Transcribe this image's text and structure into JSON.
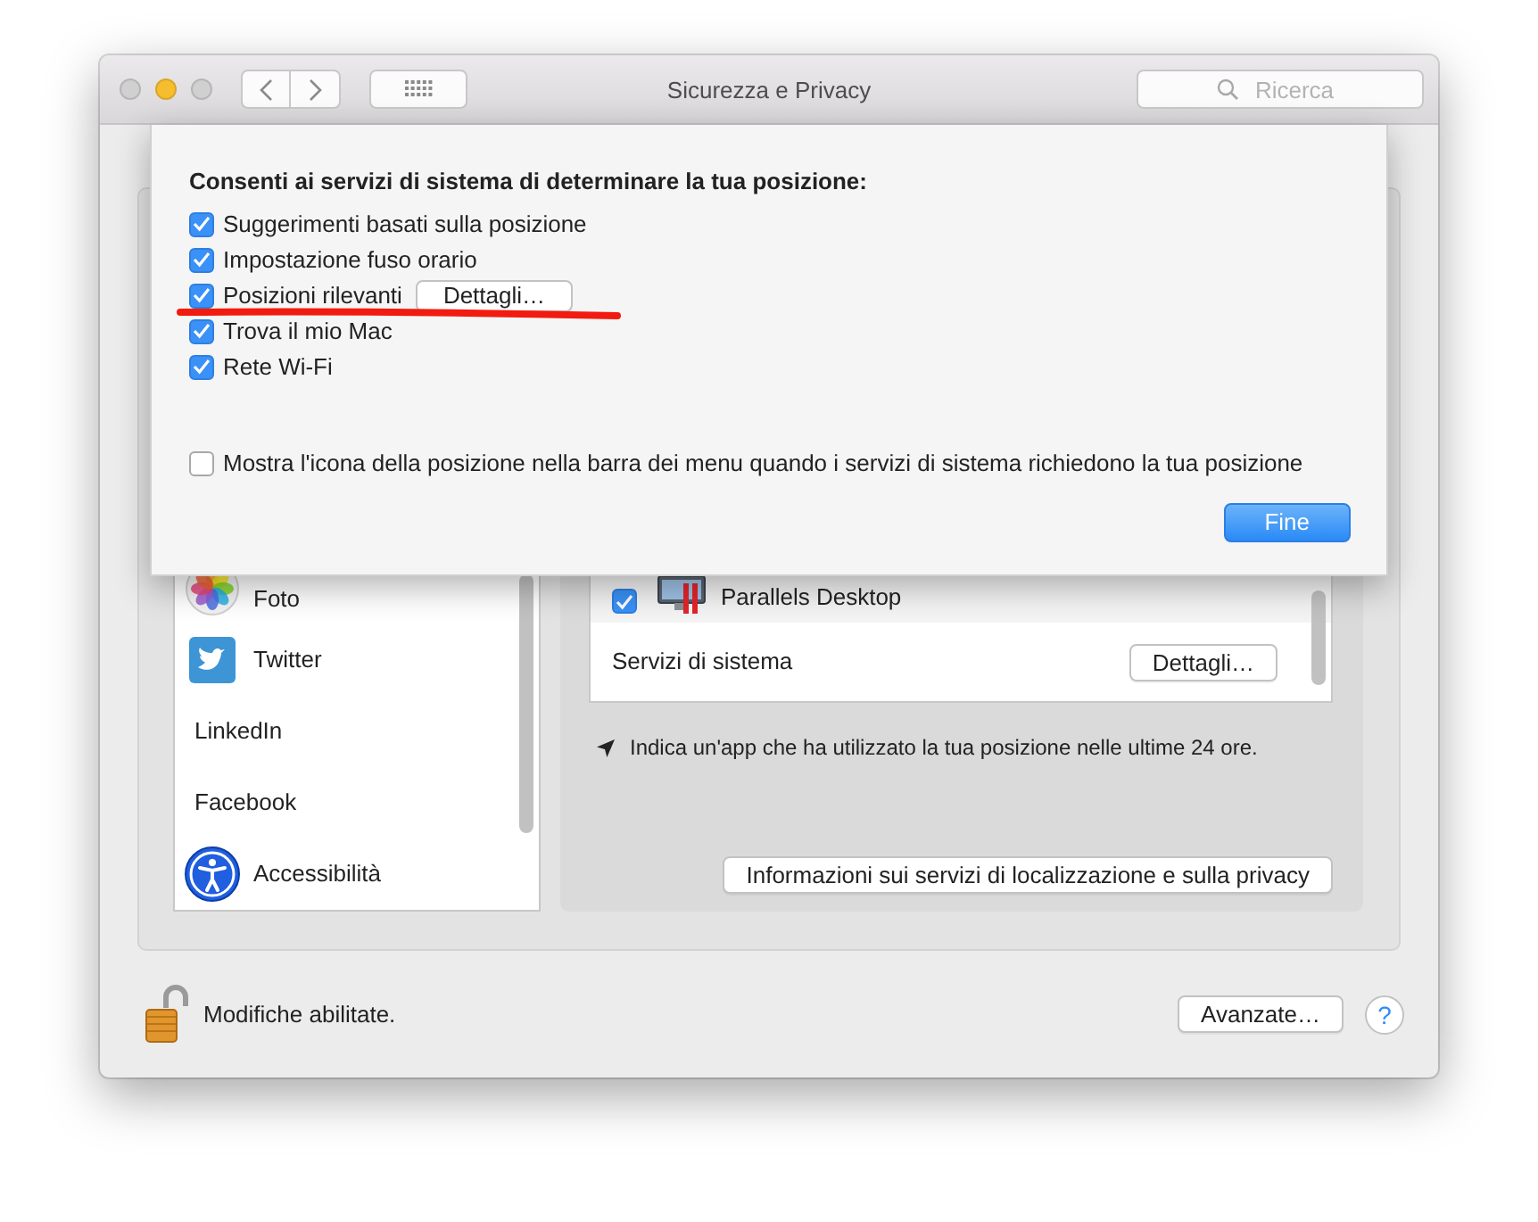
{
  "window": {
    "title": "Sicurezza e Privacy",
    "search": {
      "placeholder": "Ricerca"
    }
  },
  "sheet": {
    "heading": "Consenti ai servizi di sistema di determinare la tua posizione:",
    "services": [
      {
        "label": "Suggerimenti basati sulla posizione",
        "checked": true,
        "underlined": false
      },
      {
        "label": "Impostazione fuso orario",
        "checked": true,
        "underlined": false
      },
      {
        "label": "Posizioni rilevanti",
        "checked": true,
        "underlined": true,
        "button": "Dettagli…"
      },
      {
        "label": "Trova il mio Mac",
        "checked": true,
        "underlined": false
      },
      {
        "label": "Rete Wi-Fi",
        "checked": true,
        "underlined": false
      }
    ],
    "menu_icon_option": {
      "label": "Mostra l'icona della posizione nella barra dei menu quando i servizi di sistema richiedono la tua posizione",
      "checked": false
    },
    "done_button": "Fine"
  },
  "app_list": [
    {
      "label": "Foto",
      "kind": "photos"
    },
    {
      "label": "Twitter",
      "kind": "twitter"
    },
    {
      "label": "LinkedIn",
      "kind": "plain"
    },
    {
      "label": "Facebook",
      "kind": "plain"
    },
    {
      "label": "Accessibilità",
      "kind": "accessibility"
    }
  ],
  "location_apps": [
    {
      "kind": "app",
      "label": "Parallels Desktop",
      "checked": true
    },
    {
      "kind": "system",
      "label": "Servizi di sistema",
      "button": "Dettagli…"
    }
  ],
  "legend": "Indica un'app che ha utilizzato la tua posizione nelle ultime 24 ore.",
  "info_button": "Informazioni sui servizi di localizzazione e sulla privacy",
  "lock": {
    "label": "Modifiche abilitate.",
    "locked": false
  },
  "advanced_button": "Avanzate…",
  "help_button": "?"
}
